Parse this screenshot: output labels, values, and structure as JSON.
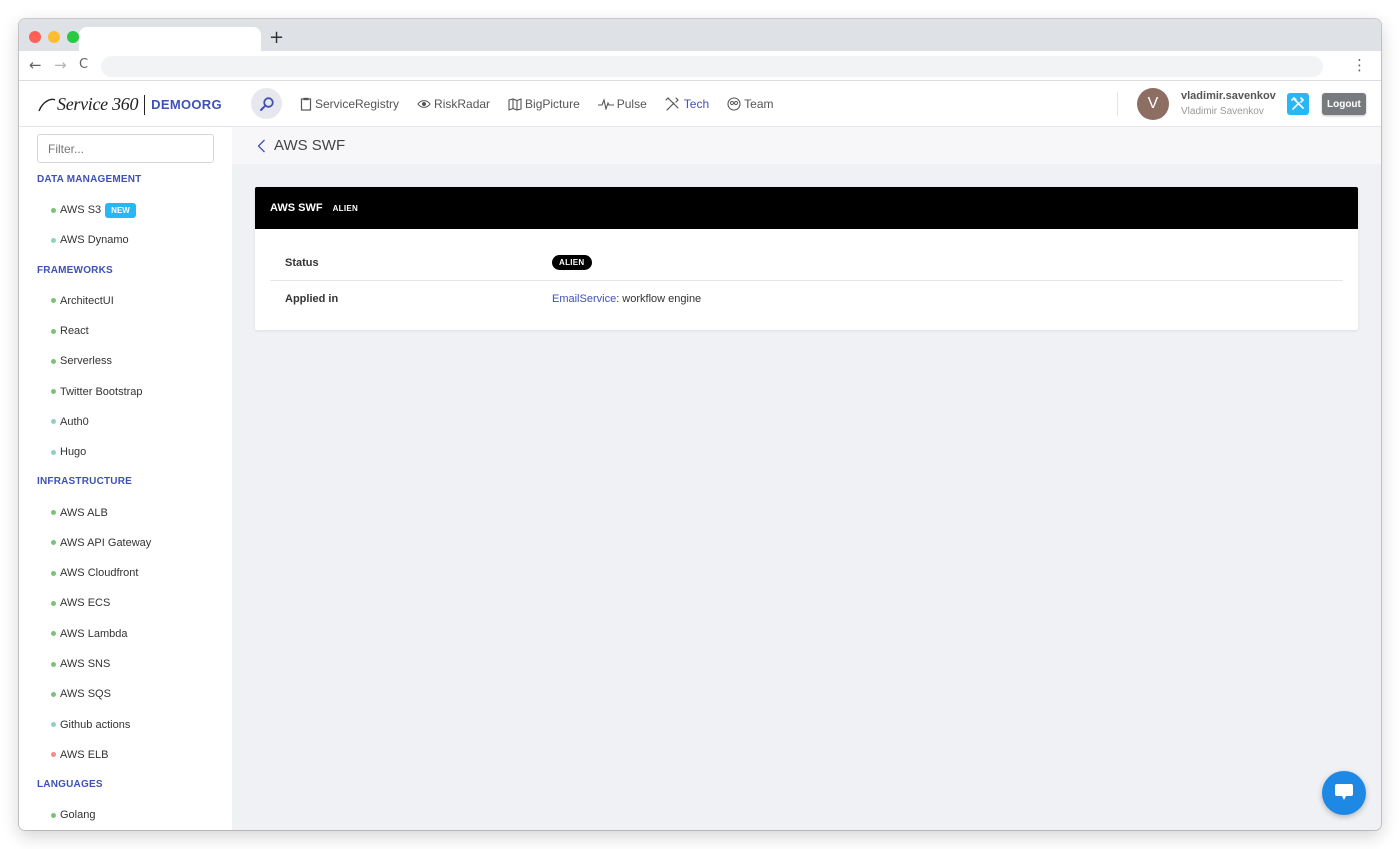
{
  "browser": {
    "new_tab_glyph": "+",
    "back_glyph": "←",
    "forward_glyph": "→",
    "reload_glyph": "C",
    "menu_glyph": "⋮",
    "traffic_lights": [
      "#fe5f57",
      "#febc2e",
      "#28c840"
    ]
  },
  "header": {
    "logo_text": "Service 360",
    "org": "DEMOORG",
    "nav": [
      {
        "label": "ServiceRegistry",
        "icon": "clipboard-icon"
      },
      {
        "label": "RiskRadar",
        "icon": "eye-icon"
      },
      {
        "label": "BigPicture",
        "icon": "map-icon"
      },
      {
        "label": "Pulse",
        "icon": "pulse-icon"
      },
      {
        "label": "Tech",
        "icon": "tools-icon"
      },
      {
        "label": "Team",
        "icon": "team-icon"
      }
    ],
    "active_nav": "Tech",
    "user": {
      "initial": "V",
      "username": "vladimir.savenkov",
      "full_name": "Vladimir Savenkov"
    },
    "logout_label": "Logout"
  },
  "sidebar": {
    "filter_placeholder": "Filter...",
    "categories": [
      {
        "title": "DATA MANAGEMENT",
        "items": [
          {
            "label": "AWS S3",
            "dot": "#7cc17a",
            "badge": "NEW"
          },
          {
            "label": "AWS Dynamo",
            "dot": "#8fd1c2"
          }
        ]
      },
      {
        "title": "FRAMEWORKS",
        "items": [
          {
            "label": "ArchitectUI",
            "dot": "#7cc17a"
          },
          {
            "label": "React",
            "dot": "#7cc17a"
          },
          {
            "label": "Serverless",
            "dot": "#7cc17a"
          },
          {
            "label": "Twitter Bootstrap",
            "dot": "#7cc17a"
          },
          {
            "label": "Auth0",
            "dot": "#8fd1c2"
          },
          {
            "label": "Hugo",
            "dot": "#8fd1c2"
          }
        ]
      },
      {
        "title": "INFRASTRUCTURE",
        "items": [
          {
            "label": "AWS ALB",
            "dot": "#7cc17a"
          },
          {
            "label": "AWS API Gateway",
            "dot": "#7cc17a"
          },
          {
            "label": "AWS Cloudfront",
            "dot": "#7cc17a"
          },
          {
            "label": "AWS ECS",
            "dot": "#7cc17a"
          },
          {
            "label": "AWS Lambda",
            "dot": "#7cc17a"
          },
          {
            "label": "AWS SNS",
            "dot": "#7cc17a"
          },
          {
            "label": "AWS SQS",
            "dot": "#7cc17a"
          },
          {
            "label": "Github actions",
            "dot": "#8fd1c2"
          },
          {
            "label": "AWS ELB",
            "dot": "#f28b8b"
          }
        ]
      },
      {
        "title": "LANGUAGES",
        "items": [
          {
            "label": "Golang",
            "dot": "#7cc17a"
          }
        ]
      }
    ]
  },
  "page": {
    "title": "AWS SWF",
    "card": {
      "title": "AWS SWF",
      "badge": "ALIEN",
      "rows": {
        "status_label": "Status",
        "status_value": "ALIEN",
        "applied_label": "Applied in",
        "applied_link": "EmailService",
        "applied_text": ": workflow engine"
      }
    }
  },
  "colors": {
    "accent": "#3f51b5",
    "tools_button": "#29b6f6",
    "chat_button": "#1e88e5"
  }
}
